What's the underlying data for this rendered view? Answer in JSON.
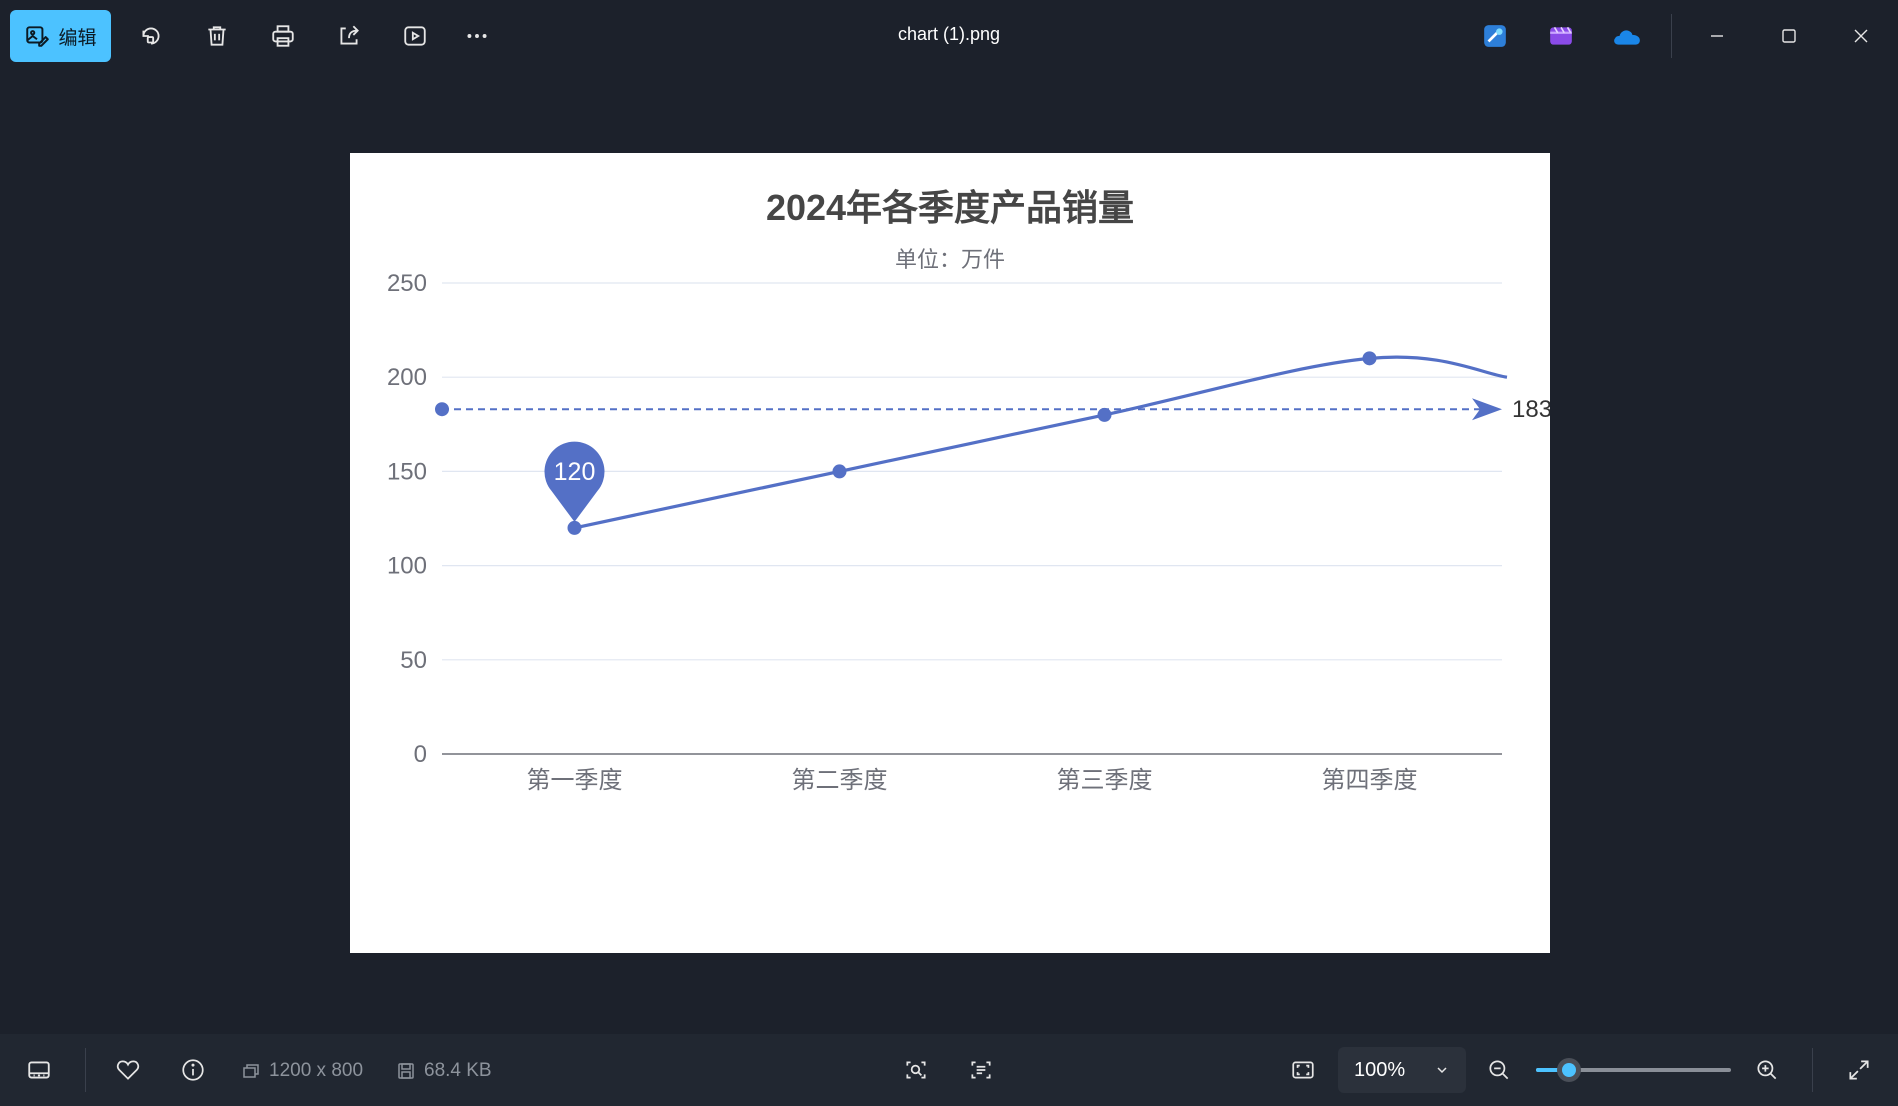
{
  "titlebar": {
    "edit_label": "编辑",
    "file_name": "chart (1).png",
    "tools": [
      "rotate-icon",
      "delete-icon",
      "print-icon",
      "share-icon",
      "slideshow-icon",
      "more-icon"
    ],
    "apps": [
      "designer-app-icon",
      "clipchamp-app-icon",
      "onedrive-app-icon"
    ]
  },
  "bottombar": {
    "dimensions": "1200 x 800",
    "file_size": "68.4 KB",
    "zoom": "100%",
    "zoom_slider_level": 0.17
  },
  "colors": {
    "accent": "#4cc2ff",
    "series": "#5470c6",
    "axis_text": "#6e7079",
    "title": "#464646"
  },
  "chart_data": {
    "type": "line",
    "title": "2024年各季度产品销量",
    "subtitle": "单位：万件",
    "categories": [
      "第一季度",
      "第二季度",
      "第三季度",
      "第四季度"
    ],
    "series": [
      {
        "values": [
          120,
          150,
          180,
          210
        ],
        "smooth": true
      }
    ],
    "ylim": [
      0,
      250
    ],
    "yticks": [
      0,
      50,
      100,
      150,
      200,
      250
    ],
    "grid": true,
    "mark_point": {
      "category": "第一季度",
      "value": 120,
      "label": "120"
    },
    "mark_line": {
      "type": "average",
      "value": 183,
      "label": "183"
    }
  }
}
